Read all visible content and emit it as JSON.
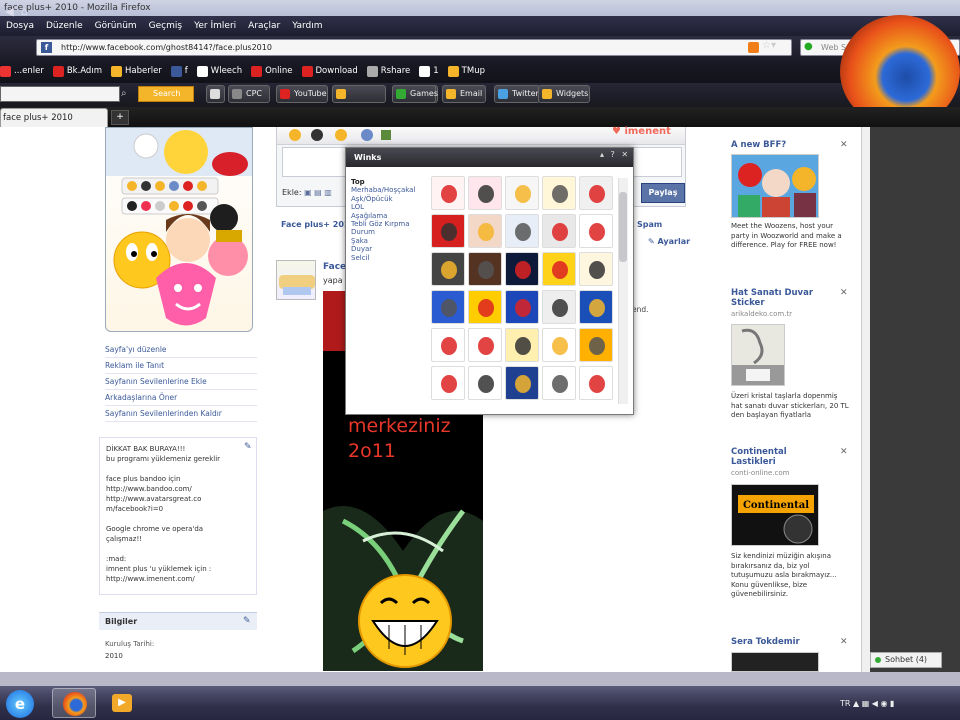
{
  "window": {
    "title": "face plus+ 2010 - Mozilla Firefox"
  },
  "menu": [
    "Dosya",
    "Düzenle",
    "Görünüm",
    "Geçmiş",
    "Yer İmleri",
    "Araçlar",
    "Yardım"
  ],
  "nav": {
    "url": "http://www.facebook.com/ghost8414?/face.plus2010",
    "search_placeholder": "Web Search"
  },
  "bookmarks": [
    {
      "label": "...enler",
      "color": "#e33"
    },
    {
      "label": "Bk.Adım",
      "color": "#d22"
    },
    {
      "label": "Haberler",
      "color": "#f5b52a"
    },
    {
      "label": "f",
      "color": "#3b5998"
    },
    {
      "label": "Wleech",
      "color": "#fff"
    },
    {
      "label": "Online",
      "color": "#d22"
    },
    {
      "label": "Download",
      "color": "#d22"
    },
    {
      "label": "Rshare",
      "color": "#aaa"
    },
    {
      "label": "1",
      "color": "#fff"
    },
    {
      "label": "TMup",
      "color": "#f5b52a"
    }
  ],
  "addon_toolbar": {
    "search_button": "Search",
    "buttons": [
      {
        "label": "",
        "color": "#ddd"
      },
      {
        "label": "CPC",
        "color": "#888"
      },
      {
        "label": "YouTube",
        "color": "#d22"
      },
      {
        "label": "",
        "color": "#f5b52a"
      },
      {
        "label": "",
        "color": "#888"
      },
      {
        "label": "Games",
        "color": "#3a3"
      },
      {
        "label": "Email",
        "color": "#f5b52a"
      },
      {
        "label": "Twitter",
        "color": "#4aa0e0"
      },
      {
        "label": "Widgets",
        "color": "#f5b52a"
      }
    ]
  },
  "tabs": [
    {
      "label": "face plus+ 2010"
    }
  ],
  "left_links": [
    "Sayfa'yı düzenle",
    "Reklam ile Tanıt",
    "Sayfanın Sevilenlerine Ekle",
    "Arkadaşlarına Öner",
    "Sayfanın Sevilenlerinden Kaldır"
  ],
  "info_box_lines": [
    "DİKKAT BAK BURAYA!!!",
    "bu programı yüklemeniz gereklir",
    "",
    "face plus bandoo için",
    "http://www.bandoo.com/",
    "http://www.avatarsgreat.co",
    "m/facebook?i=0",
    "",
    "Google chrome ve opera'da",
    "çalışmaz!!",
    "",
    ":mad:",
    "imnent plus 'u yüklemek için :",
    "http://www.imenent.com/"
  ],
  "bilgiler": {
    "heading": "Bilgiler",
    "label": "Kuruluş Tarihi:",
    "value": "2010"
  },
  "composer": {
    "ekle_label": "Ekle:",
    "share_button": "Paylaş",
    "brand": "imenent"
  },
  "feed": {
    "title": "Face plus+ 2010",
    "name": "Face",
    "sub": "yapa",
    "spam": "Spam",
    "settings": "Ayarlar",
    "tail": "end."
  },
  "poster": {
    "line1": "merkeziniz",
    "line2": "2o11"
  },
  "winks_popup": {
    "title": "Winks",
    "controls": "▴ ? ✕",
    "categories": [
      "Top",
      "Merhaba/Hoşçakal",
      "Aşk/Öpücük",
      "LOL",
      "Aşağılama",
      "Tebli Göz Kırpma",
      "Durum",
      "Şaka",
      "Duyar",
      "Selcil"
    ],
    "grid": [
      [
        "#fff3f3",
        "#ffe6ec",
        "#f6f6f6",
        "#fff7d8",
        "#f0f0f0"
      ],
      [
        "#d62020",
        "#f3d7c7",
        "#e8eef8",
        "#e8e8e8",
        "#ffffff"
      ],
      [
        "#444444",
        "#553322",
        "#0d1a3a",
        "#ffd21a",
        "#fff6e0"
      ],
      [
        "#2a5bd0",
        "#ffcc00",
        "#1b47b8",
        "#eeeeee",
        "#1a4fb8"
      ],
      [
        "#ffffff",
        "#ffffff",
        "#fff0b0",
        "#ffffff",
        "#ffb000"
      ],
      [
        "#ffffff",
        "#ffffff",
        "#1f3f90",
        "#ffffff",
        "#ffffff"
      ]
    ]
  },
  "ads": [
    {
      "title": "A new BFF?",
      "url": "",
      "text": "Meet the Woozens, host your party in Woozworld and make a difference. Play for FREE now!",
      "color": "#5aa6e0"
    },
    {
      "title": "Hat Sanatı Duvar Sticker",
      "url": "arikaldeko.com.tr",
      "text": "Üzeri kristal taşlarla dopenmiş hat sanatı duvar stickerları, 20 TL den başlayan fiyatlarla",
      "color": "#e8e8e0"
    },
    {
      "title": "Continental Lastikleri",
      "url": "conti-online.com",
      "text": "Siz kendinizi müziğin akışına bırakırsanız da, biz yol tutuşumuzu asla bırakmayız... Konu güvenlikse, bize güvenebilirsiniz.",
      "color": "#111111"
    },
    {
      "title": "Sera Tokdemir",
      "url": "",
      "text": "",
      "color": "#222222"
    }
  ],
  "ad_brand": "Continental",
  "chat": {
    "label": "Sohbet (4)"
  },
  "tray": {
    "lang": "TR"
  },
  "colors": {
    "facebook_blue": "#3b5998",
    "taskbar": "#30304a",
    "poster_red": "#e8372a"
  }
}
